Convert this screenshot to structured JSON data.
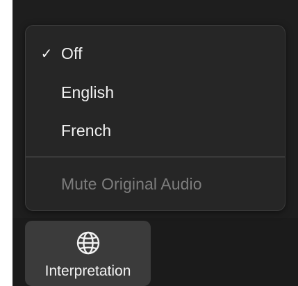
{
  "menu": {
    "items": [
      {
        "label": "Off",
        "checked": true
      },
      {
        "label": "English",
        "checked": false
      },
      {
        "label": "French",
        "checked": false
      }
    ],
    "mute_label": "Mute Original Audio",
    "check_glyph": "✓"
  },
  "toolbar": {
    "interpretation_label": "Interpretation",
    "icon": "globe-icon"
  },
  "colors": {
    "menu_bg": "#262626",
    "toolbar_button_bg": "#3b3b3b",
    "text": "#f2f2f2",
    "disabled_text": "#7d7d7d"
  }
}
